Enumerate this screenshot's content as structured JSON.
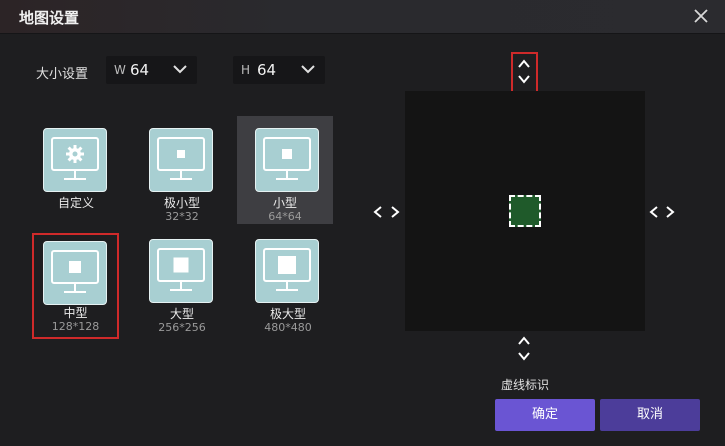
{
  "window": {
    "title": "地图设置"
  },
  "size": {
    "label": "大小设置",
    "width": {
      "prefix": "W",
      "value": "64"
    },
    "height": {
      "prefix": "H",
      "value": "64"
    }
  },
  "presets": [
    {
      "name": "自定义",
      "dims": "",
      "icon": "gear-icon"
    },
    {
      "name": "极小型",
      "dims": "32*32"
    },
    {
      "name": "小型",
      "dims": "64*64",
      "selected": true
    },
    {
      "name": "中型",
      "dims": "128*128"
    },
    {
      "name": "大型",
      "dims": "256*256"
    },
    {
      "name": "极大型",
      "dims": "480*480"
    }
  ],
  "footer": {
    "hint": "虚线标识",
    "ok_label": "确定",
    "cancel_label": "取消"
  },
  "colors": {
    "accent": "#6a55d3",
    "cancel": "#4c3d9a",
    "monitor": "#a8cfd2",
    "marker": "#1f5a2a",
    "highlight": "#cf2a2a"
  }
}
